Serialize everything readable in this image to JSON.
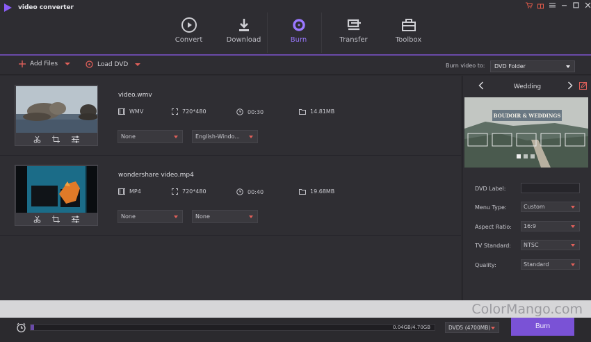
{
  "app": {
    "title": "video converter"
  },
  "window_controls": [
    "cart-icon",
    "gift-icon",
    "menu-icon",
    "minimize-icon",
    "maximize-icon",
    "close-icon"
  ],
  "nav": [
    {
      "label": "Convert",
      "icon": "play-circle-icon",
      "active": false
    },
    {
      "label": "Download",
      "icon": "download-icon",
      "active": false
    },
    {
      "label": "Burn",
      "icon": "disc-icon",
      "active": true
    },
    {
      "label": "Transfer",
      "icon": "transfer-icon",
      "active": false
    },
    {
      "label": "Toolbox",
      "icon": "toolbox-icon",
      "active": false
    }
  ],
  "toolbar": {
    "add_files": "Add Files",
    "load_dvd": "Load DVD",
    "burn_to_label": "Burn video to:",
    "burn_to_value": "DVD Folder"
  },
  "files": [
    {
      "name": "video.wmv",
      "format": "WMV",
      "resolution": "720*480",
      "duration": "00:30",
      "size": "14.81MB",
      "subtitle": "None",
      "audio": "English-Windo..."
    },
    {
      "name": "wondershare video.mp4",
      "format": "MP4",
      "resolution": "720*480",
      "duration": "00:40",
      "size": "19.68MB",
      "subtitle": "None",
      "audio": "None"
    }
  ],
  "template": {
    "name": "Wedding",
    "preview_title": "BOUDOIR & WEDDINGS"
  },
  "props": {
    "dvd_label": {
      "label": "DVD Label:",
      "value": ""
    },
    "menu_type": {
      "label": "Menu Type:",
      "value": "Custom"
    },
    "aspect_ratio": {
      "label": "Aspect Ratio:",
      "value": "16:9"
    },
    "tv_standard": {
      "label": "TV Standard:",
      "value": "NTSC"
    },
    "quality": {
      "label": "Quality:",
      "value": "Standard"
    }
  },
  "bottom": {
    "progress_text": "0.04GB/4.70GB",
    "progress_fraction": 0.009,
    "disc_type": "DVD5 (4700MB)",
    "burn_label": "Burn"
  },
  "watermark": "ColorMango.com",
  "colors": {
    "accent": "#7a52d6",
    "caret": "#e0605a"
  }
}
